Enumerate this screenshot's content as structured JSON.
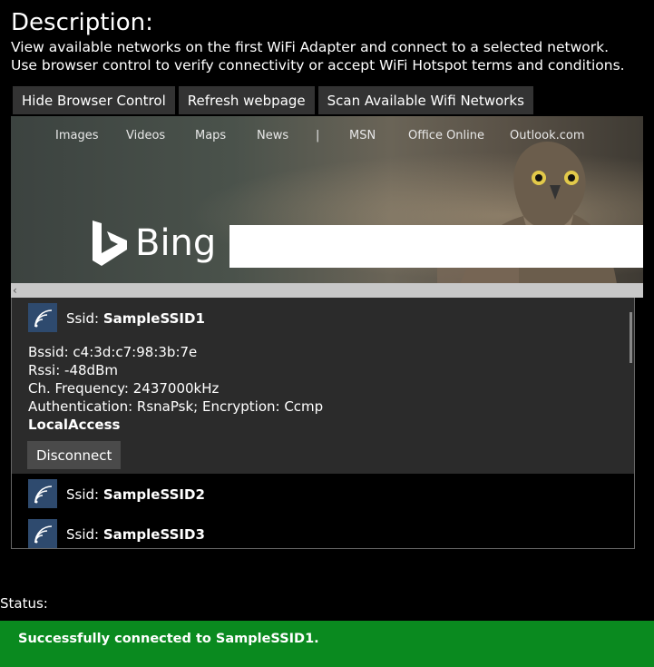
{
  "header": {
    "title": "Description:",
    "line1": "View available networks on the first WiFi Adapter and connect to a selected network.",
    "line2": "Use browser control to verify connectivity or accept WiFi Hotspot terms and conditions."
  },
  "toolbar": {
    "hide_browser": "Hide Browser Control",
    "refresh": "Refresh webpage",
    "scan": "Scan Available Wifi Networks"
  },
  "browser": {
    "nav": [
      "Images",
      "Videos",
      "Maps",
      "News",
      "|",
      "MSN",
      "Office Online",
      "Outlook.com"
    ],
    "brand": "Bing",
    "search_value": ""
  },
  "networks": {
    "ssid_label": "Ssid:",
    "selected": {
      "ssid": "SampleSSID1",
      "bssid": "Bssid: c4:3d:c7:98:3b:7e",
      "rssi": "Rssi: -48dBm",
      "frequency": "Ch. Frequency: 2437000kHz",
      "auth": "Authentication: RsnaPsk; Encryption: Ccmp",
      "access": "LocalAccess",
      "action": "Disconnect"
    },
    "items": [
      {
        "ssid": "SampleSSID2"
      },
      {
        "ssid": "SampleSSID3"
      }
    ]
  },
  "status": {
    "label": "Status:",
    "message": "Successfully connected to SampleSSID1.",
    "color": "#0a8a1f"
  }
}
